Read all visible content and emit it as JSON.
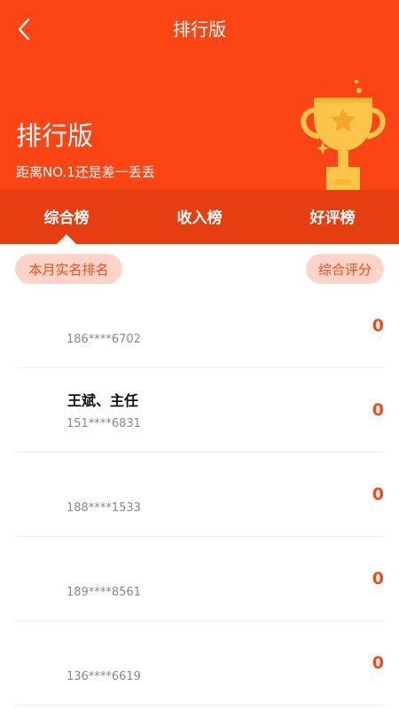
{
  "nav": {
    "back_icon": "chevron-left-icon",
    "title": "排行版"
  },
  "hero": {
    "title": "排行版",
    "subtitle": "距离NO.1还是差一丢丢",
    "trophy_icon": "trophy-icon"
  },
  "colors": {
    "primary": "#fb4514",
    "tab_bar": "#e43e11",
    "pill_bg": "#ffd4c8",
    "accent_text": "#f44a1a",
    "trophy": "#fcc54a"
  },
  "tabs": [
    {
      "label": "综合榜",
      "active": true
    },
    {
      "label": "收入榜",
      "active": false
    },
    {
      "label": "好评榜",
      "active": false
    }
  ],
  "filters": {
    "left_label": "本月实名排名",
    "right_label": "综合评分"
  },
  "ranking": [
    {
      "name": "",
      "phone": "186****6702",
      "score": "0"
    },
    {
      "name": "王斌、主任",
      "phone": "151****6831",
      "score": "0"
    },
    {
      "name": "",
      "phone": "188****1533",
      "score": "0"
    },
    {
      "name": "",
      "phone": "189****8561",
      "score": "0"
    },
    {
      "name": "",
      "phone": "136****6619",
      "score": "0"
    }
  ]
}
